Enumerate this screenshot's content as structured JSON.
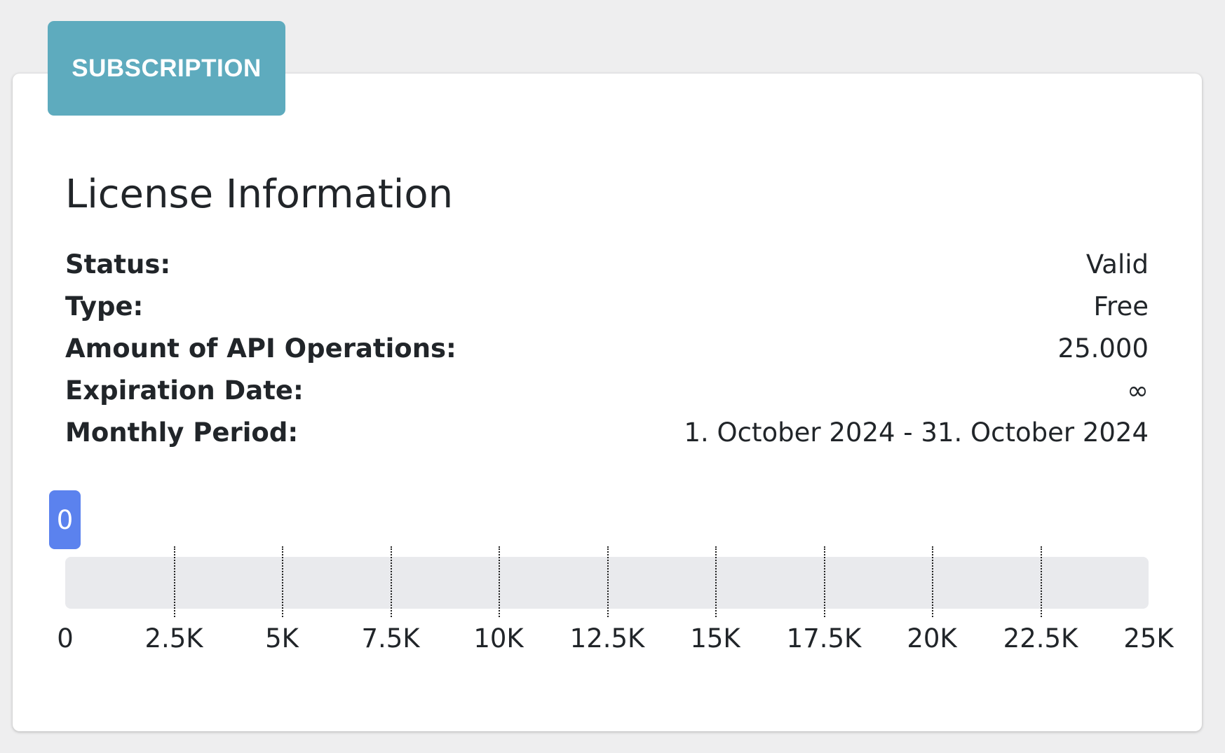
{
  "tab": {
    "label": "SUBSCRIPTION"
  },
  "license": {
    "title": "License Information",
    "rows": [
      {
        "label": "Status:",
        "value": "Valid"
      },
      {
        "label": "Type:",
        "value": "Free"
      },
      {
        "label": "Amount of API Operations:",
        "value": "25.000"
      },
      {
        "label": "Expiration Date:",
        "value": "∞"
      },
      {
        "label": "Monthly Period:",
        "value": "1. October 2024 - 31. October 2024"
      }
    ]
  },
  "usage": {
    "current_label": "0",
    "current_value": 0,
    "max_value": 25000,
    "ticks": [
      "0",
      "2.5K",
      "5K",
      "7.5K",
      "10K",
      "12.5K",
      "15K",
      "17.5K",
      "20K",
      "22.5K",
      "25K"
    ],
    "colors": {
      "fill": "#5b82ee",
      "track": "#e9eaed",
      "tab": "#5eabbe"
    }
  }
}
